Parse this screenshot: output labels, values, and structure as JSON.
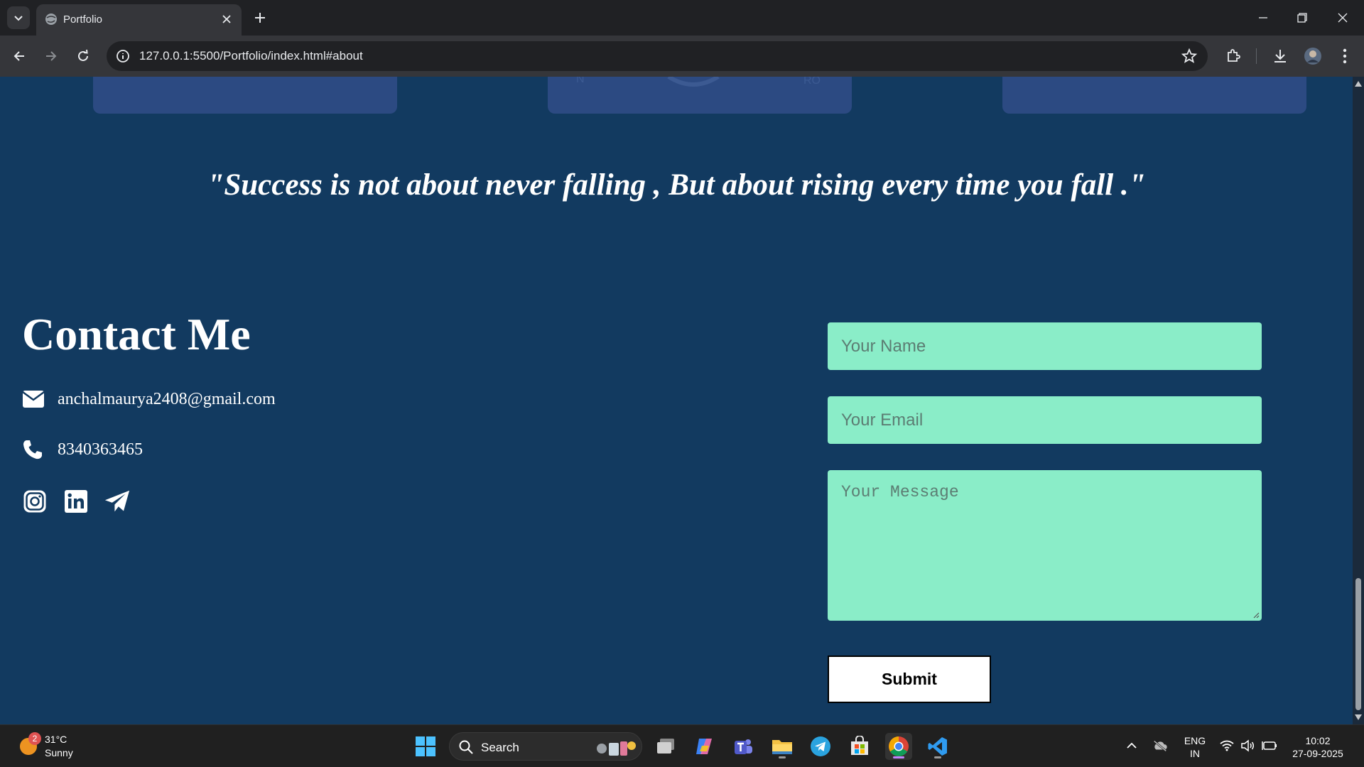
{
  "browser": {
    "tab_title": "Portfolio",
    "url": "127.0.0.1:5500/Portfolio/index.html#about"
  },
  "page": {
    "quote": "\"Success is not about never falling , But about rising every time you fall .\"",
    "contact": {
      "title": "Contact Me",
      "email": "anchalmaurya2408@gmail.com",
      "phone": "8340363465",
      "socials": [
        "instagram-icon",
        "linkedin-icon",
        "telegram-icon"
      ]
    },
    "form": {
      "name_placeholder": "Your Name",
      "email_placeholder": "Your Email",
      "message_placeholder": "Your Message",
      "submit_label": "Submit"
    },
    "colors": {
      "background": "#123a60",
      "field": "#8aedc8",
      "card": "#2c4a82"
    }
  },
  "taskbar": {
    "weather": {
      "temp": "31°C",
      "condition": "Sunny",
      "badge": "2"
    },
    "search_label": "Search",
    "language": {
      "line1": "ENG",
      "line2": "IN"
    },
    "time": "10:02",
    "date": "27-09-2025"
  }
}
